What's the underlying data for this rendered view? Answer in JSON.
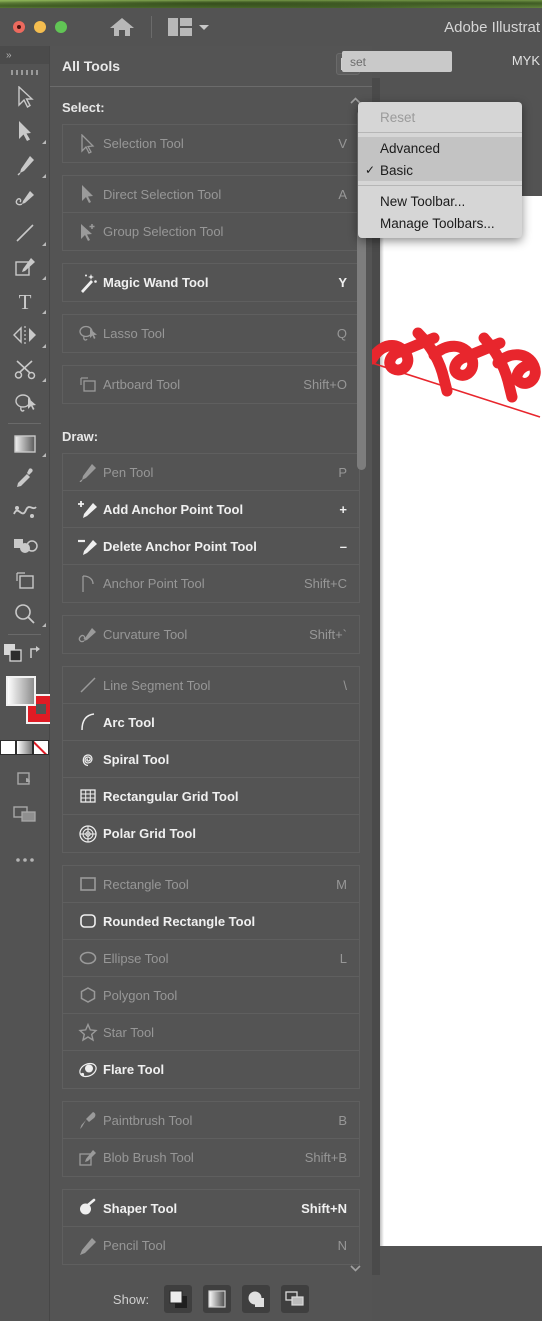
{
  "window": {
    "title": "Adobe Illustrat",
    "traffic_lights": [
      "close",
      "minimize",
      "zoom"
    ],
    "home_icon": "home-icon",
    "layout_icon": "layout-switcher-icon",
    "chevron_icon": "chevron-down-icon"
  },
  "control_bar": {
    "preset_placeholder": "set",
    "color_mode": "MYK"
  },
  "left_toolbar": {
    "collapse_label": "»",
    "tools": [
      {
        "name": "selection-tool",
        "icon": "arrow-outline-icon",
        "flyout": false
      },
      {
        "name": "direct-selection-tool",
        "icon": "arrow-filled-icon",
        "flyout": true
      },
      {
        "name": "pen-tool",
        "icon": "pen-icon",
        "flyout": true
      },
      {
        "name": "curvature-tool",
        "icon": "curvature-pen-icon",
        "flyout": false
      },
      {
        "name": "line-segment-tool",
        "icon": "line-icon",
        "flyout": true
      },
      {
        "name": "blob-brush-tool",
        "icon": "blob-brush-icon",
        "flyout": true
      },
      {
        "name": "type-tool",
        "icon": "type-t-icon",
        "flyout": true
      },
      {
        "name": "rotate-reflect-tool",
        "icon": "reflect-icon",
        "flyout": true
      },
      {
        "name": "scissors-tool",
        "icon": "scissors-icon",
        "flyout": true
      },
      {
        "name": "lasso-tool",
        "icon": "lasso-icon",
        "flyout": false
      },
      {
        "name": "gradient-tool",
        "icon": "gradient-square-icon",
        "flyout": true
      },
      {
        "name": "eyedropper-tool",
        "icon": "eyedropper-icon",
        "flyout": false
      },
      {
        "name": "blend-tool",
        "icon": "blend-icon",
        "flyout": false
      },
      {
        "name": "shape-builder-tool",
        "icon": "shape-builder-icon",
        "flyout": false
      },
      {
        "name": "artboard-tool",
        "icon": "artboard-icon",
        "flyout": false
      },
      {
        "name": "zoom-tool",
        "icon": "magnifier-icon",
        "flyout": true
      }
    ],
    "fill_stroke": {
      "fill_color": "#FDFDFD",
      "stroke_color": "#E01B24",
      "swap_icon": "swap-arrow-icon",
      "default_icon": "default-fill-stroke-icon"
    },
    "mini_swatches": [
      "color",
      "gradient",
      "none"
    ],
    "draw_mode_icon": "draw-normal-icon",
    "screen_mode_icon": "screen-mode-icon",
    "more_icon": "ellipsis-icon"
  },
  "panel": {
    "title": "All Tools",
    "menu_button_icon": "list-menu-icon",
    "scroll_up_icon": "chevron-up-icon",
    "scroll_down_icon": "chevron-down-icon",
    "sections": [
      {
        "label": "Select:",
        "groups": [
          [
            {
              "label": "Selection Tool",
              "key": "V",
              "icon": "arrow-outline-icon",
              "enabled": false
            }
          ],
          [
            {
              "label": "Direct Selection Tool",
              "key": "A",
              "icon": "arrow-filled-icon",
              "enabled": false
            },
            {
              "label": "Group Selection Tool",
              "key": "",
              "icon": "group-select-icon",
              "enabled": false
            }
          ],
          [
            {
              "label": "Magic Wand Tool",
              "key": "Y",
              "icon": "magic-wand-icon",
              "enabled": true
            }
          ],
          [
            {
              "label": "Lasso Tool",
              "key": "Q",
              "icon": "lasso-icon",
              "enabled": false
            }
          ],
          [
            {
              "label": "Artboard Tool",
              "key": "Shift+O",
              "icon": "artboard-icon",
              "enabled": false
            }
          ]
        ]
      },
      {
        "label": "Draw:",
        "groups": [
          [
            {
              "label": "Pen Tool",
              "key": "P",
              "icon": "pen-icon",
              "enabled": false
            },
            {
              "label": "Add Anchor Point Tool",
              "key": "+",
              "icon": "pen-plus-icon",
              "enabled": true
            },
            {
              "label": "Delete Anchor Point Tool",
              "key": "–",
              "icon": "pen-minus-icon",
              "enabled": true
            },
            {
              "label": "Anchor Point Tool",
              "key": "Shift+C",
              "icon": "anchor-point-icon",
              "enabled": false
            }
          ],
          [
            {
              "label": "Curvature Tool",
              "key": "Shift+`",
              "icon": "curvature-pen-icon",
              "enabled": false
            }
          ],
          [
            {
              "label": "Line Segment Tool",
              "key": "\\",
              "icon": "line-icon",
              "enabled": false
            },
            {
              "label": "Arc Tool",
              "key": "",
              "icon": "arc-icon",
              "enabled": true
            },
            {
              "label": "Spiral Tool",
              "key": "",
              "icon": "spiral-icon",
              "enabled": true
            },
            {
              "label": "Rectangular Grid Tool",
              "key": "",
              "icon": "rect-grid-icon",
              "enabled": true
            },
            {
              "label": "Polar Grid Tool",
              "key": "",
              "icon": "polar-grid-icon",
              "enabled": true
            }
          ],
          [
            {
              "label": "Rectangle Tool",
              "key": "M",
              "icon": "rectangle-icon",
              "enabled": false
            },
            {
              "label": "Rounded Rectangle Tool",
              "key": "",
              "icon": "rounded-rectangle-icon",
              "enabled": true
            },
            {
              "label": "Ellipse Tool",
              "key": "L",
              "icon": "ellipse-icon",
              "enabled": false
            },
            {
              "label": "Polygon Tool",
              "key": "",
              "icon": "polygon-icon",
              "enabled": false
            },
            {
              "label": "Star Tool",
              "key": "",
              "icon": "star-icon",
              "enabled": false
            },
            {
              "label": "Flare Tool",
              "key": "",
              "icon": "flare-icon",
              "enabled": true
            }
          ],
          [
            {
              "label": "Paintbrush Tool",
              "key": "B",
              "icon": "paintbrush-icon",
              "enabled": false
            },
            {
              "label": "Blob Brush Tool",
              "key": "Shift+B",
              "icon": "blob-brush-icon",
              "enabled": false
            }
          ],
          [
            {
              "label": "Shaper Tool",
              "key": "Shift+N",
              "icon": "shaper-icon",
              "enabled": true
            },
            {
              "label": "Pencil Tool",
              "key": "N",
              "icon": "pencil-icon",
              "enabled": false
            }
          ]
        ]
      }
    ],
    "show_bar": {
      "label": "Show:",
      "buttons": [
        {
          "name": "fill-stroke-toggle",
          "icon": "fill-stroke-icon"
        },
        {
          "name": "color-gradient-toggle",
          "icon": "gradient-icon"
        },
        {
          "name": "drawing-modes-toggle",
          "icon": "draw-modes-icon"
        },
        {
          "name": "screen-mode-toggle",
          "icon": "screen-modes-icon"
        }
      ]
    }
  },
  "menu": {
    "items": [
      {
        "label": "Reset",
        "enabled": false,
        "checked": false,
        "highlighted": false
      },
      {
        "separator": true
      },
      {
        "label": "Advanced",
        "enabled": true,
        "checked": false,
        "highlighted": true
      },
      {
        "label": "Basic",
        "enabled": true,
        "checked": true,
        "highlighted": true
      },
      {
        "separator": true
      },
      {
        "label": "New Toolbar...",
        "enabled": true,
        "checked": false,
        "highlighted": false
      },
      {
        "label": "Manage Toolbars...",
        "enabled": true,
        "checked": false,
        "highlighted": false
      }
    ]
  },
  "artwork": {
    "name": "red-zigzag-brush-stroke",
    "color": "#E8262D"
  }
}
